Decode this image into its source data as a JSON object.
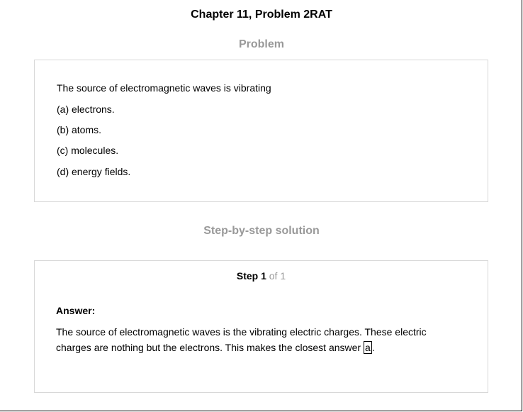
{
  "title": "Chapter 11, Problem 2RAT",
  "problem": {
    "heading": "Problem",
    "question": "The source of electromagnetic waves is vibrating",
    "options": [
      "(a) electrons.",
      "(b) atoms.",
      "(c) molecules.",
      "(d) energy fields."
    ]
  },
  "solution": {
    "heading": "Step-by-step solution",
    "step_label": "Step 1",
    "step_of": "of 1",
    "answer_label": "Answer:",
    "answer_text_before": "The source of electromagnetic waves is the vibrating electric charges. These electric charges are nothing but the electrons. This makes the closest answer ",
    "answer_choice": "a",
    "answer_text_after": "."
  }
}
